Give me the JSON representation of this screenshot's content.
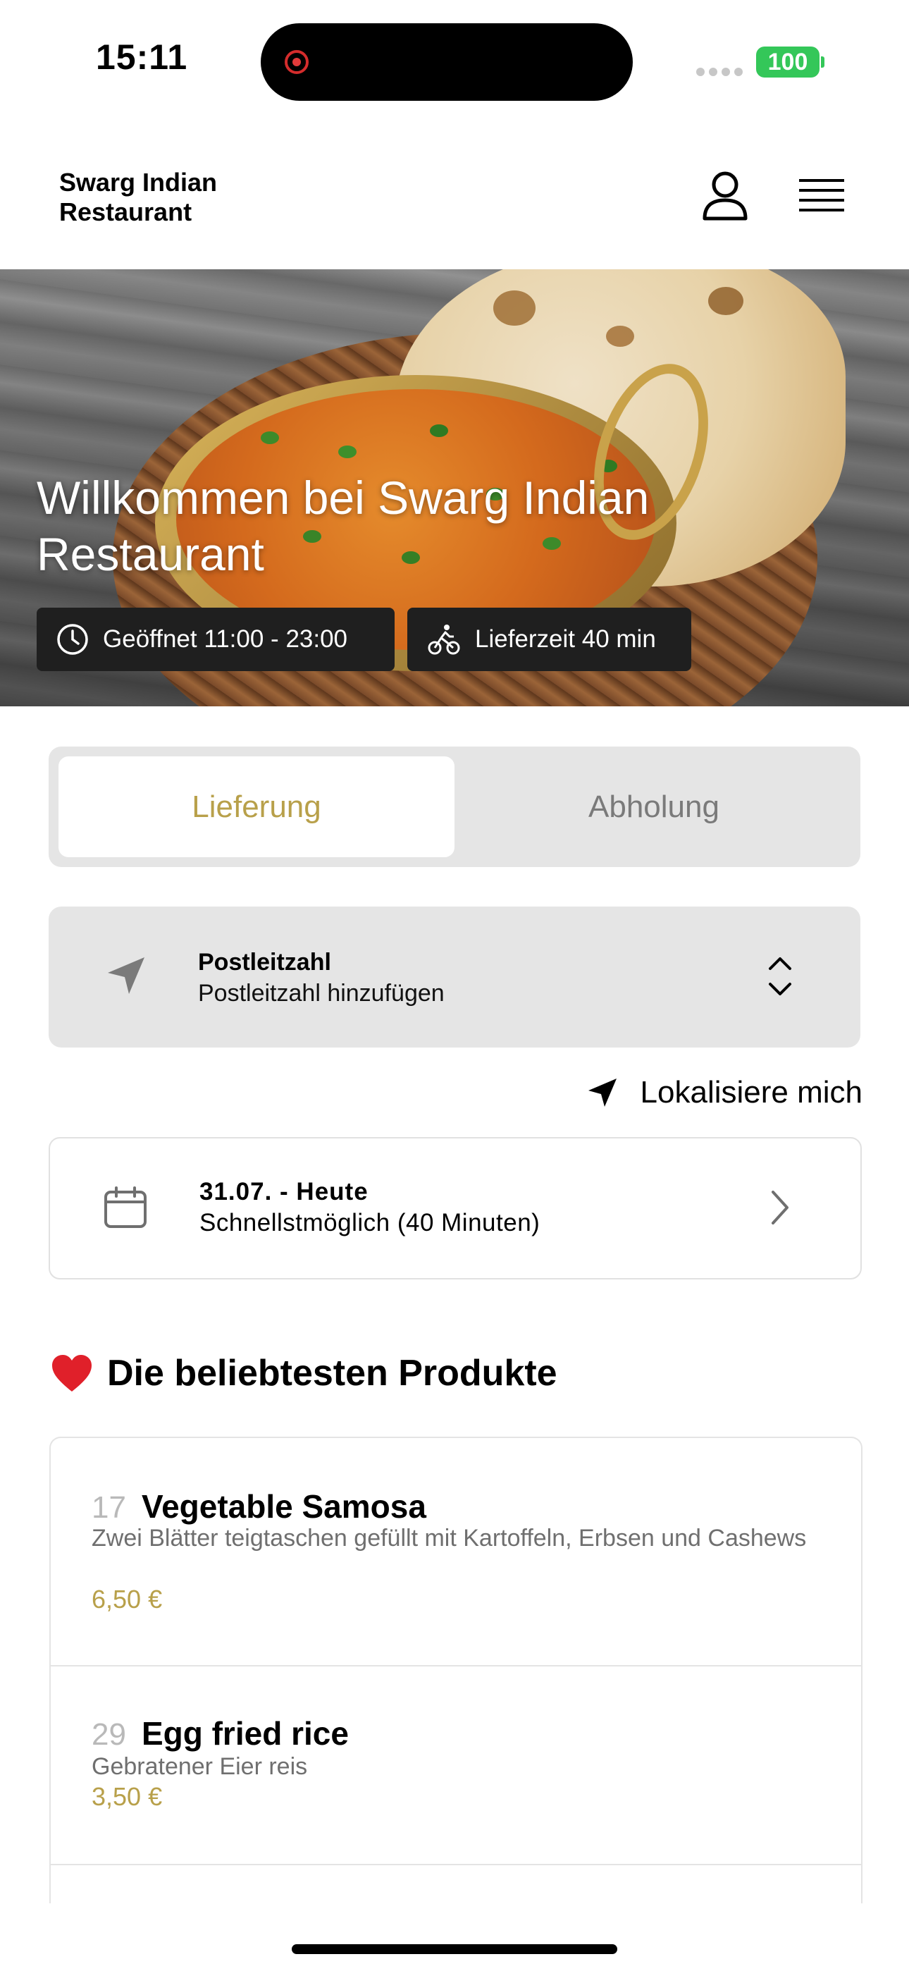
{
  "status_bar": {
    "time": "15:11",
    "battery": "100"
  },
  "header": {
    "title": "Swarg Indian Restaurant",
    "icons": [
      "user-icon",
      "menu-icon"
    ]
  },
  "hero": {
    "title": "Willkommen bei Swarg Indian Restaurant",
    "opening_hours": "Geöffnet 11:00 - 23:00",
    "delivery_time": "Lieferzeit 40 min"
  },
  "order_mode": {
    "tabs": [
      {
        "label": "Lieferung",
        "active": true
      },
      {
        "label": "Abholung",
        "active": false
      }
    ]
  },
  "postal_code": {
    "label": "Postleitzahl",
    "value": "Postleitzahl hinzufügen"
  },
  "locate": {
    "label": "Lokalisiere mich"
  },
  "delivery_date": {
    "label": "31.07. - Heute",
    "value": "Schnellstmöglich (40 Minuten)"
  },
  "popular": {
    "title": "Die beliebtesten Produkte",
    "products": [
      {
        "number": "17",
        "name": "Vegetable Samosa",
        "description": "Zwei Blätter teigtaschen gefüllt mit Kartoffeln, Erbsen und Cashews",
        "price": "6,50 €"
      },
      {
        "number": "29",
        "name": "Egg fried rice",
        "description": "Gebratener Eier reis",
        "price": "3,50 €"
      }
    ]
  },
  "colors": {
    "accent": "#b8a04a",
    "battery": "#34c759",
    "panel": "#e5e5e5"
  }
}
